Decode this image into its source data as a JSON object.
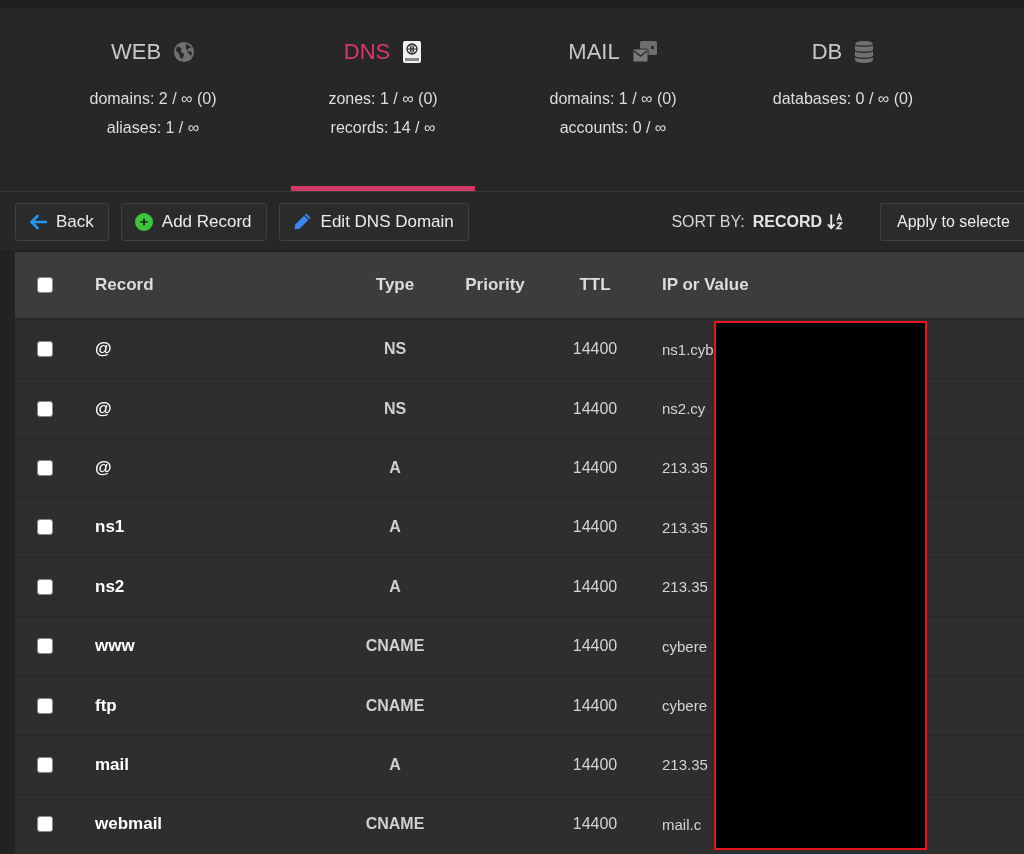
{
  "tabs": [
    {
      "label": "WEB",
      "selected": false,
      "stats": [
        "domains: 2 / ∞ (0)",
        "aliases: 1 / ∞"
      ]
    },
    {
      "label": "DNS",
      "selected": true,
      "stats": [
        "zones: 1 / ∞ (0)",
        "records: 14 / ∞"
      ]
    },
    {
      "label": "MAIL",
      "selected": false,
      "stats": [
        "domains: 1 / ∞ (0)",
        "accounts: 0 / ∞"
      ]
    },
    {
      "label": "DB",
      "selected": false,
      "stats": [
        "databases: 0 / ∞ (0)"
      ]
    }
  ],
  "toolbar": {
    "buttons": [
      {
        "label": "Back"
      },
      {
        "label": "Add Record"
      },
      {
        "label": "Edit DNS Domain"
      }
    ],
    "sort": {
      "label": "SORT BY:",
      "value": "RECORD"
    },
    "bulk_action": {
      "label": "Apply to selecte"
    }
  },
  "table": {
    "select_all": {
      "checked": false
    },
    "columns": [
      "Record",
      "Type",
      "Priority",
      "TTL",
      "IP or Value"
    ],
    "rows": [
      {
        "checked": false,
        "record": "@",
        "type": "NS",
        "ttl": "14400",
        "value": "ns1.cyb"
      },
      {
        "checked": false,
        "record": "@",
        "type": "NS",
        "ttl": "14400",
        "value": "ns2.cy"
      },
      {
        "checked": false,
        "record": "@",
        "type": "A",
        "ttl": "14400",
        "value": "213.35"
      },
      {
        "checked": false,
        "record": "ns1",
        "type": "A",
        "ttl": "14400",
        "value": "213.35"
      },
      {
        "checked": false,
        "record": "ns2",
        "type": "A",
        "ttl": "14400",
        "value": "213.35"
      },
      {
        "checked": false,
        "record": "www",
        "type": "CNAME",
        "ttl": "14400",
        "value": "cybere"
      },
      {
        "checked": false,
        "record": "ftp",
        "type": "CNAME",
        "ttl": "14400",
        "value": "cybere"
      },
      {
        "checked": false,
        "record": "mail",
        "type": "A",
        "ttl": "14400",
        "value": "213.35"
      },
      {
        "checked": false,
        "record": "webmail",
        "type": "CNAME",
        "ttl": "14400",
        "value": "mail.c"
      }
    ]
  }
}
